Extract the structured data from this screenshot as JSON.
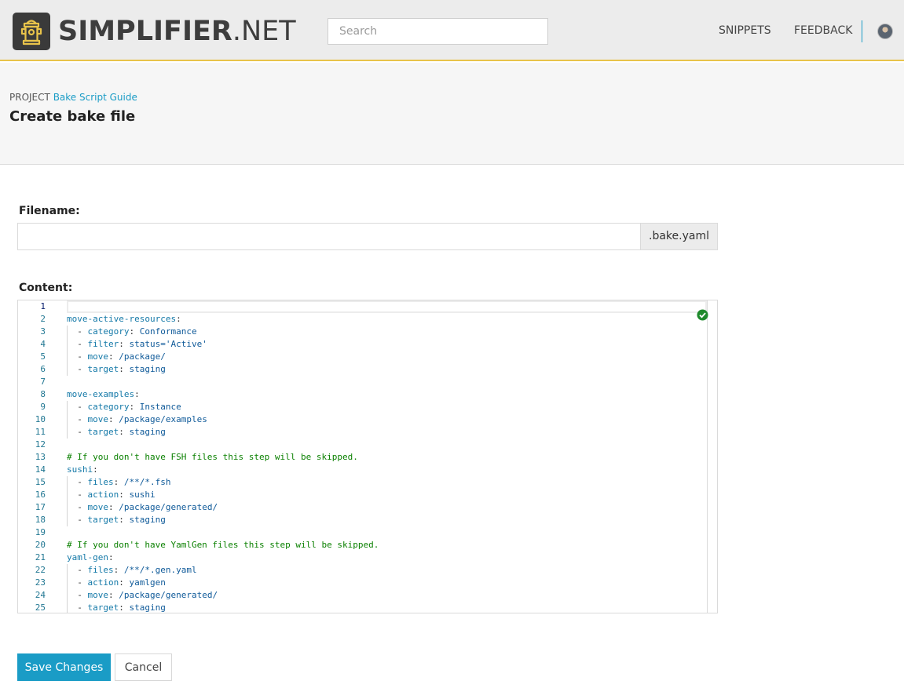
{
  "header": {
    "brand_bold": "SIMPLIFIER",
    "brand_rest": ".NET",
    "logo_icon": "fire-hydrant-icon",
    "search_placeholder": "Search",
    "nav": [
      "SNIPPETS",
      "FEEDBACK"
    ],
    "accent_color": "#e8c34a"
  },
  "breadcrumb": {
    "prefix": "PROJECT",
    "project_link": "Bake Script Guide"
  },
  "page_title": "Create bake file",
  "form": {
    "filename_label": "Filename:",
    "filename_value": "",
    "filename_suffix": ".bake.yaml",
    "content_label": "Content:",
    "status_icon": "valid-check-icon"
  },
  "editor_lines": [
    {
      "n": "1",
      "kind": "empty",
      "key": "",
      "value": ""
    },
    {
      "n": "2",
      "kind": "section",
      "key": "move-active-resources",
      "value": ""
    },
    {
      "n": "3",
      "kind": "item",
      "key": "category",
      "value": "Conformance"
    },
    {
      "n": "4",
      "kind": "item",
      "key": "filter",
      "value": "status='Active'"
    },
    {
      "n": "5",
      "kind": "item",
      "key": "move",
      "value": "/package/"
    },
    {
      "n": "6",
      "kind": "item",
      "key": "target",
      "value": "staging"
    },
    {
      "n": "7",
      "kind": "empty",
      "key": "",
      "value": ""
    },
    {
      "n": "8",
      "kind": "section",
      "key": "move-examples",
      "value": ""
    },
    {
      "n": "9",
      "kind": "item",
      "key": "category",
      "value": "Instance"
    },
    {
      "n": "10",
      "kind": "item",
      "key": "move",
      "value": "/package/examples"
    },
    {
      "n": "11",
      "kind": "item",
      "key": "target",
      "value": "staging"
    },
    {
      "n": "12",
      "kind": "empty",
      "key": "",
      "value": ""
    },
    {
      "n": "13",
      "kind": "comment",
      "key": "# If you don't have FSH files this step will be skipped.",
      "value": ""
    },
    {
      "n": "14",
      "kind": "section",
      "key": "sushi",
      "value": ""
    },
    {
      "n": "15",
      "kind": "item",
      "key": "files",
      "value": "/**/*.fsh"
    },
    {
      "n": "16",
      "kind": "item",
      "key": "action",
      "value": "sushi"
    },
    {
      "n": "17",
      "kind": "item",
      "key": "move",
      "value": "/package/generated/"
    },
    {
      "n": "18",
      "kind": "item",
      "key": "target",
      "value": "staging"
    },
    {
      "n": "19",
      "kind": "empty",
      "key": "",
      "value": ""
    },
    {
      "n": "20",
      "kind": "comment",
      "key": "# If you don't have YamlGen files this step will be skipped.",
      "value": ""
    },
    {
      "n": "21",
      "kind": "section",
      "key": "yaml-gen",
      "value": ""
    },
    {
      "n": "22",
      "kind": "item",
      "key": "files",
      "value": "/**/*.gen.yaml"
    },
    {
      "n": "23",
      "kind": "item",
      "key": "action",
      "value": "yamlgen"
    },
    {
      "n": "24",
      "kind": "item",
      "key": "move",
      "value": "/package/generated/"
    },
    {
      "n": "25",
      "kind": "item",
      "key": "target",
      "value": "staging"
    }
  ],
  "buttons": {
    "save": "Save Changes",
    "cancel": "Cancel",
    "primary_color": "#1a9cc6"
  }
}
